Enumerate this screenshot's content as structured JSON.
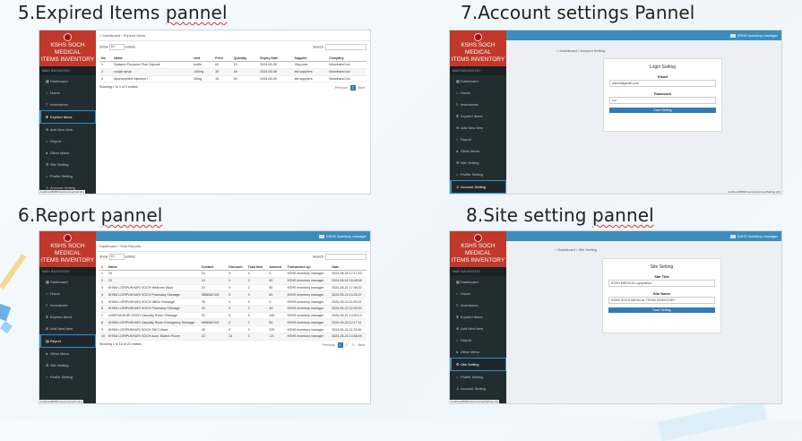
{
  "titles": {
    "expired": {
      "pre": "5.Expired Items ",
      "sq": "pannel"
    },
    "account": {
      "pre": "7.Account settings Pannel",
      "sq": ""
    },
    "report": {
      "pre": "6.Report ",
      "sq": "pannel"
    },
    "site": {
      "pre": "8.Site setting ",
      "sq": "pannel"
    }
  },
  "brand": {
    "line1": "KSHS SOCH MEDICAL",
    "line2": "ITEMS INVENTORY"
  },
  "nav_header": "MAIN NAVIGATION",
  "nav": {
    "dashboard": "Dashboard",
    "home": "Home",
    "inventories": "Inventories",
    "expired": "Expired Items",
    "add_new": "Add New Item",
    "report": "Report",
    "other_menu": "Other Menu",
    "site_setting": "Site Setting",
    "profile_setting": "Profile Setting",
    "account_setting": "Account Setting"
  },
  "topbar_user": "KSHS inventory manager",
  "status_url": {
    "expired": "localhost/8080/inventory/expired.php",
    "account": "localhost/8080/inventory/accountSetting.php",
    "report": "localhost/8080/inventory/report.php",
    "site": "localhost/8080/inventory/siteSetting.php"
  },
  "expired": {
    "crumb_home": "Dashboard",
    "crumb_current": "Expired Items",
    "show": "Show",
    "show_value": "10",
    "entries": "entries",
    "search": "Search:",
    "columns": [
      "No",
      "Name",
      "Unit",
      "Price",
      "Quantity",
      "Expiry Date",
      "Supplier",
      "Company"
    ],
    "rows": [
      [
        "1",
        "Spasmo-Proxyvon Plus Capsule",
        "bottle",
        "60",
        "10",
        "2024-05-30",
        "Ying.com",
        "Woodhand Ltd"
      ],
      [
        "2",
        "cough syrup",
        "100mg",
        "30",
        "49",
        "2024-05-08",
        "abi suppliers",
        "Woodhand Ltd"
      ],
      [
        "3",
        "Apomorphine Injection I",
        "10mg",
        "15",
        "30",
        "2024-05-09",
        "abi suppliers",
        "Woodhand Ltd"
      ]
    ],
    "info": "Showing 1 to 3 of 3 entries",
    "prev": "Previous",
    "page": "1",
    "next": "Next"
  },
  "account": {
    "crumb_home": "Dashboard",
    "crumb_current": "Account Setting",
    "card_title": "Login Setting",
    "email_label": "Email",
    "email_value": "admin@gmail.com",
    "password_label": "Password",
    "password_value": "••••",
    "save": "Save Setting"
  },
  "report": {
    "crumb_home": "Dashboard",
    "crumb_current": "Sold Reports",
    "show": "Show",
    "show_value": "10",
    "entries": "entries",
    "search": "Search:",
    "columns": [
      "#",
      "Name",
      "Contact",
      "Discount",
      "Total Item",
      "Amount",
      "Transaction by:",
      "Date"
    ],
    "rows": [
      [
        "1",
        "23",
        "10",
        "0",
        "3",
        "0",
        "KSHS inventory manager",
        "2024-06-20 17:17:33"
      ],
      [
        "2",
        "23",
        "10",
        "0",
        "2",
        "80",
        "KSHS inventory manager",
        "2024-06-02 15:45:06"
      ],
      [
        "3",
        "KHSM LGRIPUKHURI SOCH Medicine Ward",
        "23",
        "0",
        "2",
        "80",
        "KSHS inventory manager",
        "2024-05-21 17:40:22"
      ],
      [
        "4",
        "KHSM LGRIPUKHURI SOCH Pharmacy Sheaage",
        "9856567421",
        "0",
        "3",
        "60",
        "KSHS inventory manager",
        "2024-05-24 10:20:27"
      ],
      [
        "5",
        "KHSM LGRIPUKHURI SOCH NBSU Sheaage",
        "78",
        "0",
        "3",
        "0",
        "KSHS inventory manager",
        "2024-05-24 11:00:15"
      ],
      [
        "6",
        "KHSM LGRIPUKHURI SOCH Pharmacy Sheaage",
        "23",
        "0",
        "2",
        "40",
        "KSHS inventory manager",
        "2024-05-22 22:03:20"
      ],
      [
        "7",
        "LGRIPUKHURI SOCH Casualty Room Sheaage",
        "23",
        "0",
        "6",
        "190",
        "KSHS inventory manager",
        "2024-05-21 14:03:13"
      ],
      [
        "8",
        "KHSM LGRIPUKHURI Casualty Room Emergency Sheaage",
        "9856567421",
        "0",
        "2",
        "50",
        "KSHS inventory manager",
        "2024-05-20 12:17:11"
      ],
      [
        "9",
        "KHSM LGRIPUKHURI SOCH SNCI Ward",
        "45",
        "0",
        "3",
        "220",
        "KSHS inventory manager",
        "2024-05-20 11:33:49"
      ],
      [
        "10",
        "KHSM LGRIPUKHURI SOCH Asoli. Matron Room",
        "23",
        "23",
        "3",
        "-23",
        "KSHS inventory manager",
        "2024-05-20 10:58:09"
      ]
    ],
    "info": "Showing 1 to 10 of 22 entries",
    "prev": "Previous",
    "pages": [
      "1",
      "2",
      "3"
    ],
    "next": "Next"
  },
  "site": {
    "crumb_home": "Dashboard",
    "crumb_current": "Site Setting",
    "card_title": "Site Setting",
    "title_label": "Site Title",
    "title_value": "KSHS MEDICAL Lgripukhuri",
    "name_label": "Site Name",
    "name_value": "KSHS SOCH MEDICAL ITEMS INVENTORY",
    "save": "Save Setting"
  },
  "colors": {
    "sidebar": "#222d32",
    "brand": "#c0392b",
    "accent": "#3c8dbc"
  }
}
